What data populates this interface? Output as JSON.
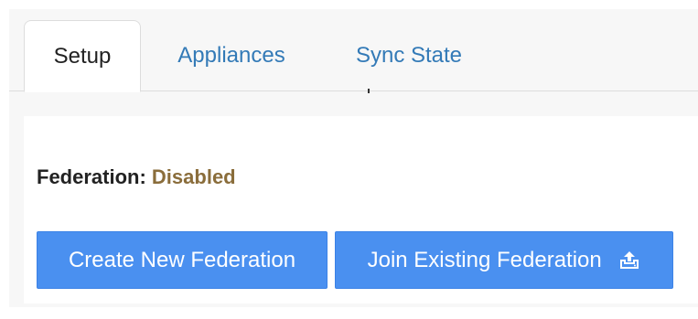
{
  "tabs": [
    {
      "label": "Setup",
      "active": true
    },
    {
      "label": "Appliances",
      "active": false
    },
    {
      "label": "Sync State",
      "active": false
    }
  ],
  "federation": {
    "label": "Federation:",
    "status": "Disabled"
  },
  "buttons": {
    "create": "Create New Federation",
    "join": "Join Existing Federation",
    "join_icon": "upload-icon"
  },
  "colors": {
    "tab_link": "#337ab7",
    "status_disabled": "#8a6d3b",
    "button_primary": "#4a90f0"
  }
}
